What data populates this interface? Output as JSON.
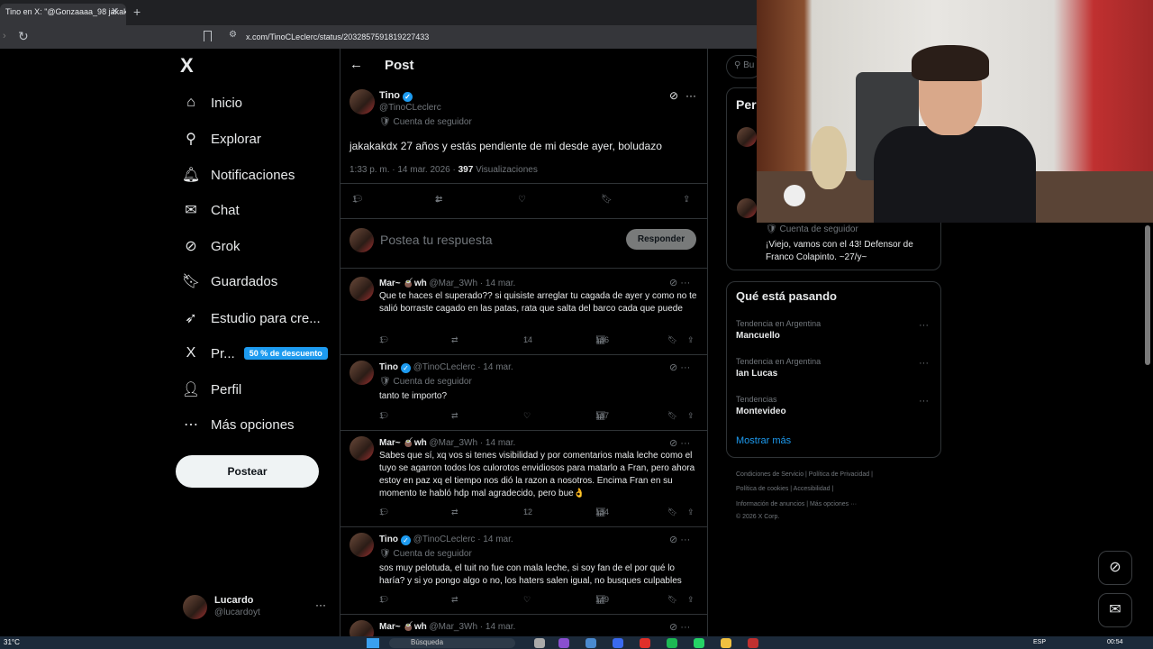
{
  "browser": {
    "tab_title": "Tino en X: \"@Gonzaaaa_98 jakaka",
    "tab_close": "✕",
    "new_tab": "+",
    "url": "x.com/TinoCLeclerc/status/2032857591819227433"
  },
  "nav": {
    "logo": "X",
    "items": [
      {
        "label": "Inicio",
        "icon": "home-icon"
      },
      {
        "label": "Explorar",
        "icon": "search-icon"
      },
      {
        "label": "Notificaciones",
        "icon": "bell-icon"
      },
      {
        "label": "Chat",
        "icon": "mail-icon"
      },
      {
        "label": "Grok",
        "icon": "grok-icon"
      },
      {
        "label": "Guardados",
        "icon": "bookmark-icon"
      },
      {
        "label": "Estudio para cre...",
        "icon": "rocket-icon"
      },
      {
        "label": "Pr...",
        "icon": "x-logo-icon",
        "badge": "50 % de descuento"
      },
      {
        "label": "Perfil",
        "icon": "person-icon"
      },
      {
        "label": "Más opciones",
        "icon": "more-circle-icon"
      }
    ],
    "post_button": "Postear",
    "account": {
      "name": "Lucardo",
      "handle": "@lucardoyt",
      "more": "···"
    }
  },
  "post": {
    "header_title": "Post",
    "back": "←",
    "author_name": "Tino",
    "author_handle": "@TinoCLeclerc",
    "follower_label": "Cuenta de seguidor",
    "text": "jakakakdx 27 años y estás pendiente de mi desde ayer, boludazo",
    "time": "1:33 p. m. · 14 mar. 2026 · ",
    "views": "397",
    "views_label": " Visualizaciones",
    "replies": "1",
    "reposts": "1",
    "reply_placeholder": "Postea tu respuesta",
    "reply_button": "Responder"
  },
  "replies": [
    {
      "name": "Mar~ 🧉wh",
      "handle": "@Mar_3Wh · 14 mar.",
      "sub": "",
      "text": "Que te haces el superado?? si quisiste arreglar tu cagada de ayer y como no te salió borraste cagado en las patas, rata que salta del barco cada que puede",
      "replies": "1",
      "likes": "14",
      "views": "166"
    },
    {
      "name": "Tino",
      "handle": "@TinoCLeclerc · 14 mar.",
      "sub": "Cuenta de seguidor",
      "text": "tanto te importo?",
      "replies": "1",
      "likes": "",
      "views": "167"
    },
    {
      "name": "Mar~ 🧉wh",
      "handle": "@Mar_3Wh · 14 mar.",
      "sub": "",
      "text": "Sabes que sí, xq vos si tenes visibilidad y por comentarios mala leche como el tuyo se agarron todos los culorotos envidiosos para matarlo a Fran, pero ahora estoy en paz xq el tiempo nos dió la razon a nosotros. Encima Fran en su momento te habló hdp mal agradecido, pero bue👌",
      "replies": "1",
      "likes": "12",
      "views": "154"
    },
    {
      "name": "Tino",
      "handle": "@TinoCLeclerc · 14 mar.",
      "sub": "Cuenta de seguidor",
      "text": "sos muy pelotuda, el tuit no fue con mala leche, si soy fan de el por qué lo haría? y si yo pongo algo o no, los haters salen igual, no busques culpables",
      "replies": "1",
      "likes": "",
      "views": "149"
    },
    {
      "name": "Mar~ 🧉wh",
      "handle": "@Mar_3Wh · 14 mar.",
      "sub": "",
      "text": "",
      "replies": "",
      "likes": "",
      "views": ""
    }
  ],
  "right": {
    "search_placeholder": "Bu",
    "people_title": "Per",
    "people_sub": "Cuenta de seguidor",
    "people_bio": "¡Viejo, vamos con el 43! Defensor de Franco Colapinto. ~27/y~",
    "trends_title": "Qué está pasando",
    "trends": [
      {
        "category": "Tendencia en Argentina",
        "name": "Mancuello"
      },
      {
        "category": "Tendencia en Argentina",
        "name": "Ian Lucas"
      },
      {
        "category": "Tendencias",
        "name": "Montevideo"
      }
    ],
    "show_more": "Mostrar más",
    "footer": [
      "Condiciones de Servicio  |  Política de Privacidad  |",
      "Política de cookies  |  Accesibilidad  |",
      "Información de anuncios  |  Más opciones ···",
      "© 2026 X Corp."
    ]
  },
  "taskbar": {
    "temp": "31°C",
    "search": "Búsqueda",
    "lang": "ESP",
    "time": "00:54"
  },
  "colors": {
    "accent": "#1d9bf0",
    "background": "#000000",
    "muted": "#71767b",
    "border": "#2f3336"
  }
}
